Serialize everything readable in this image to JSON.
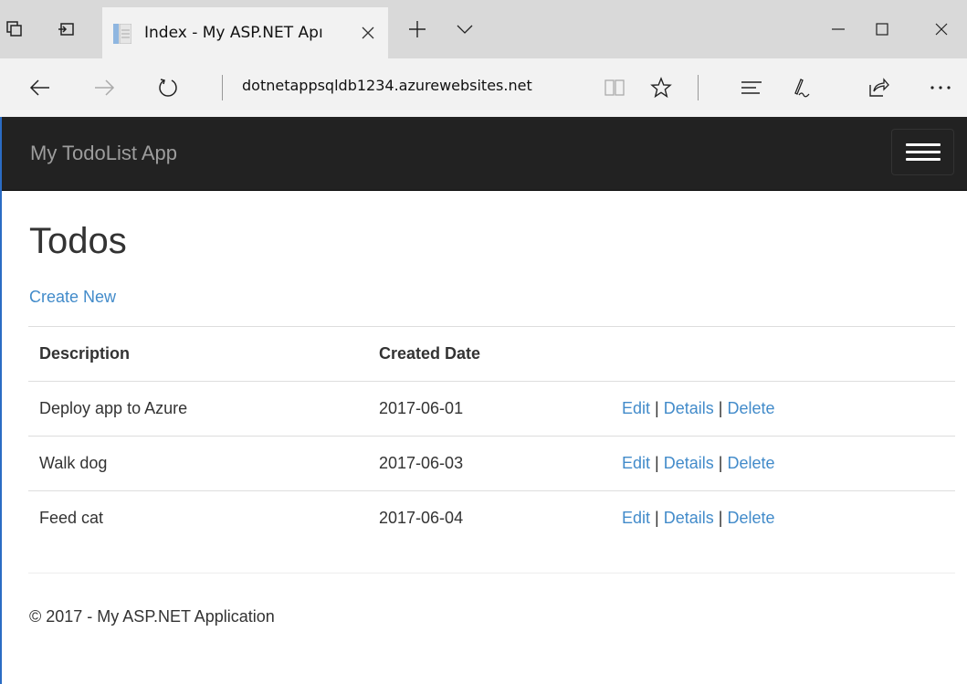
{
  "browser": {
    "tab_title": "Index - My ASP.NET Apı",
    "address": "dotnetappsqldb1234.azurewebsites.net",
    "icons": [
      "tab-preview-icon",
      "set-aside-tabs-icon",
      "page-favicon",
      "close-tab-icon",
      "new-tab-icon",
      "tab-list-chevron-icon",
      "minimize-icon",
      "maximize-icon",
      "close-window-icon",
      "back-icon",
      "forward-icon",
      "refresh-icon",
      "reading-view-icon",
      "favorites-star-icon",
      "hub-icon",
      "web-note-icon",
      "share-icon",
      "more-icon"
    ]
  },
  "app": {
    "brand": "My TodoList App",
    "nav_colors": {
      "background": "#222222",
      "brand": "#9d9d9d",
      "link": "#428bca"
    }
  },
  "page": {
    "title": "Todos",
    "create_new": "Create New",
    "columns": [
      "Description",
      "Created Date"
    ],
    "rows": [
      {
        "description": "Deploy app to Azure",
        "created": "2017-06-01",
        "edit": "Edit",
        "details": "Details",
        "delete": "Delete"
      },
      {
        "description": "Walk dog",
        "created": "2017-06-03",
        "edit": "Edit",
        "details": "Details",
        "delete": "Delete"
      },
      {
        "description": "Feed cat",
        "created": "2017-06-04",
        "edit": "Edit",
        "details": "Details",
        "delete": "Delete"
      }
    ],
    "separator": "|",
    "footer": "© 2017 - My ASP.NET Application"
  }
}
